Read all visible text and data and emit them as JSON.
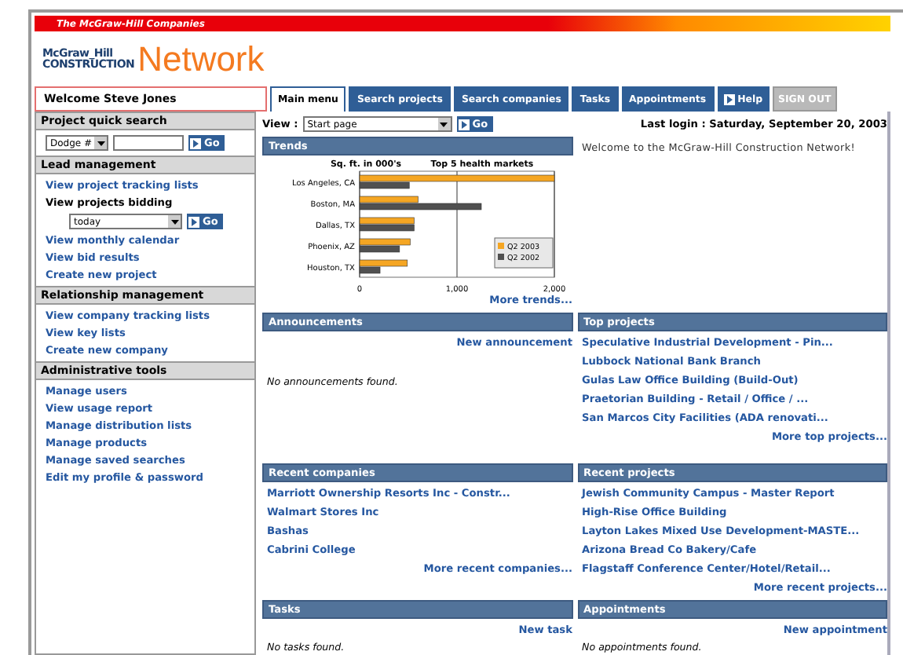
{
  "brand_bar": "The McGraw-Hill Companies",
  "logo": {
    "small_top": "McGraw_Hill",
    "small_bottom": "CONSTRUCTION",
    "big": "Network"
  },
  "welcome": "Welcome Steve Jones",
  "tabs": [
    {
      "label": "Main menu",
      "selected": true
    },
    {
      "label": "Search projects",
      "selected": false
    },
    {
      "label": "Search companies",
      "selected": false
    },
    {
      "label": "Tasks",
      "selected": false
    },
    {
      "label": "Appointments",
      "selected": false
    }
  ],
  "help_button": "Help",
  "sign_out_button": "SIGN OUT",
  "sidebar": {
    "quick_search": {
      "title": "Project quick search",
      "select": "Dodge #",
      "go": "Go"
    },
    "sections": [
      {
        "title": "Lead management",
        "items": [
          {
            "kind": "link",
            "text": "View project tracking lists"
          },
          {
            "kind": "label",
            "text": "View projects bidding"
          },
          {
            "kind": "select",
            "text": "today",
            "go": "Go"
          },
          {
            "kind": "link",
            "text": "View monthly calendar"
          },
          {
            "kind": "link",
            "text": "View bid results"
          },
          {
            "kind": "link",
            "text": "Create new project"
          }
        ]
      },
      {
        "title": "Relationship management",
        "items": [
          {
            "kind": "link",
            "text": "View company tracking lists"
          },
          {
            "kind": "link",
            "text": "View key lists"
          },
          {
            "kind": "link",
            "text": "Create new company"
          }
        ]
      },
      {
        "title": "Administrative tools",
        "items": [
          {
            "kind": "link",
            "text": "Manage users"
          },
          {
            "kind": "link",
            "text": "View usage report"
          },
          {
            "kind": "link",
            "text": "Manage distribution lists"
          },
          {
            "kind": "link",
            "text": "Manage products"
          },
          {
            "kind": "link",
            "text": "Manage saved searches"
          },
          {
            "kind": "link",
            "text": "Edit my profile & password"
          }
        ]
      }
    ]
  },
  "view_bar": {
    "label": "View :",
    "select": "Start page",
    "go": "Go"
  },
  "last_login": "Last login : Saturday, September 20, 2003",
  "trends": {
    "title": "Trends",
    "more": "More trends...",
    "chart_data": {
      "type": "bar",
      "orientation": "horizontal",
      "title": "Top 5 health markets",
      "ylabel": "Sq. ft. in 000's",
      "categories": [
        "Los Angeles, CA",
        "Boston, MA",
        "Dallas, TX",
        "Phoenix, AZ",
        "Houston, TX"
      ],
      "series": [
        {
          "name": "Q2 2003",
          "color": "#f5a623",
          "values": [
            2000,
            600,
            560,
            520,
            490
          ]
        },
        {
          "name": "Q2 2002",
          "color": "#505050",
          "values": [
            510,
            1250,
            560,
            410,
            210
          ]
        }
      ],
      "legend": true,
      "xlim": [
        0,
        2000
      ],
      "xticks": [
        0,
        {
          "value": 1000,
          "label": "1,000"
        },
        {
          "value": 2000,
          "label": "2,000"
        }
      ]
    }
  },
  "welcome_message": "Welcome to the McGraw-Hill Construction Network!",
  "panels": [
    {
      "title": "Announcements",
      "action": "New announcement",
      "empty": "No announcements found."
    },
    {
      "title": "Top projects",
      "items": [
        "Speculative Industrial Development - Pin...",
        "Lubbock National Bank Branch",
        "Gulas Law Office Building (Build-Out)",
        "Praetorian Building - Retail / Office / ...",
        "San Marcos City Facilities (ADA renovati..."
      ],
      "more": "More top projects..."
    },
    {
      "title": "Recent companies",
      "items": [
        "Marriott Ownership Resorts Inc - Constr...",
        "Walmart Stores Inc",
        "Bashas",
        "Cabrini College"
      ],
      "more": "More recent companies..."
    },
    {
      "title": "Recent projects",
      "items": [
        "Jewish Community Campus - Master Report",
        "High-Rise Office Building",
        "Layton Lakes Mixed Use Development-MASTE...",
        "Arizona Bread Co Bakery/Cafe",
        "Flagstaff Conference Center/Hotel/Retail..."
      ],
      "more": "More recent projects..."
    },
    {
      "title": "Tasks",
      "action": "New task",
      "empty": "No tasks found."
    },
    {
      "title": "Appointments",
      "action": "New appointment",
      "empty": "No appointments found."
    }
  ]
}
